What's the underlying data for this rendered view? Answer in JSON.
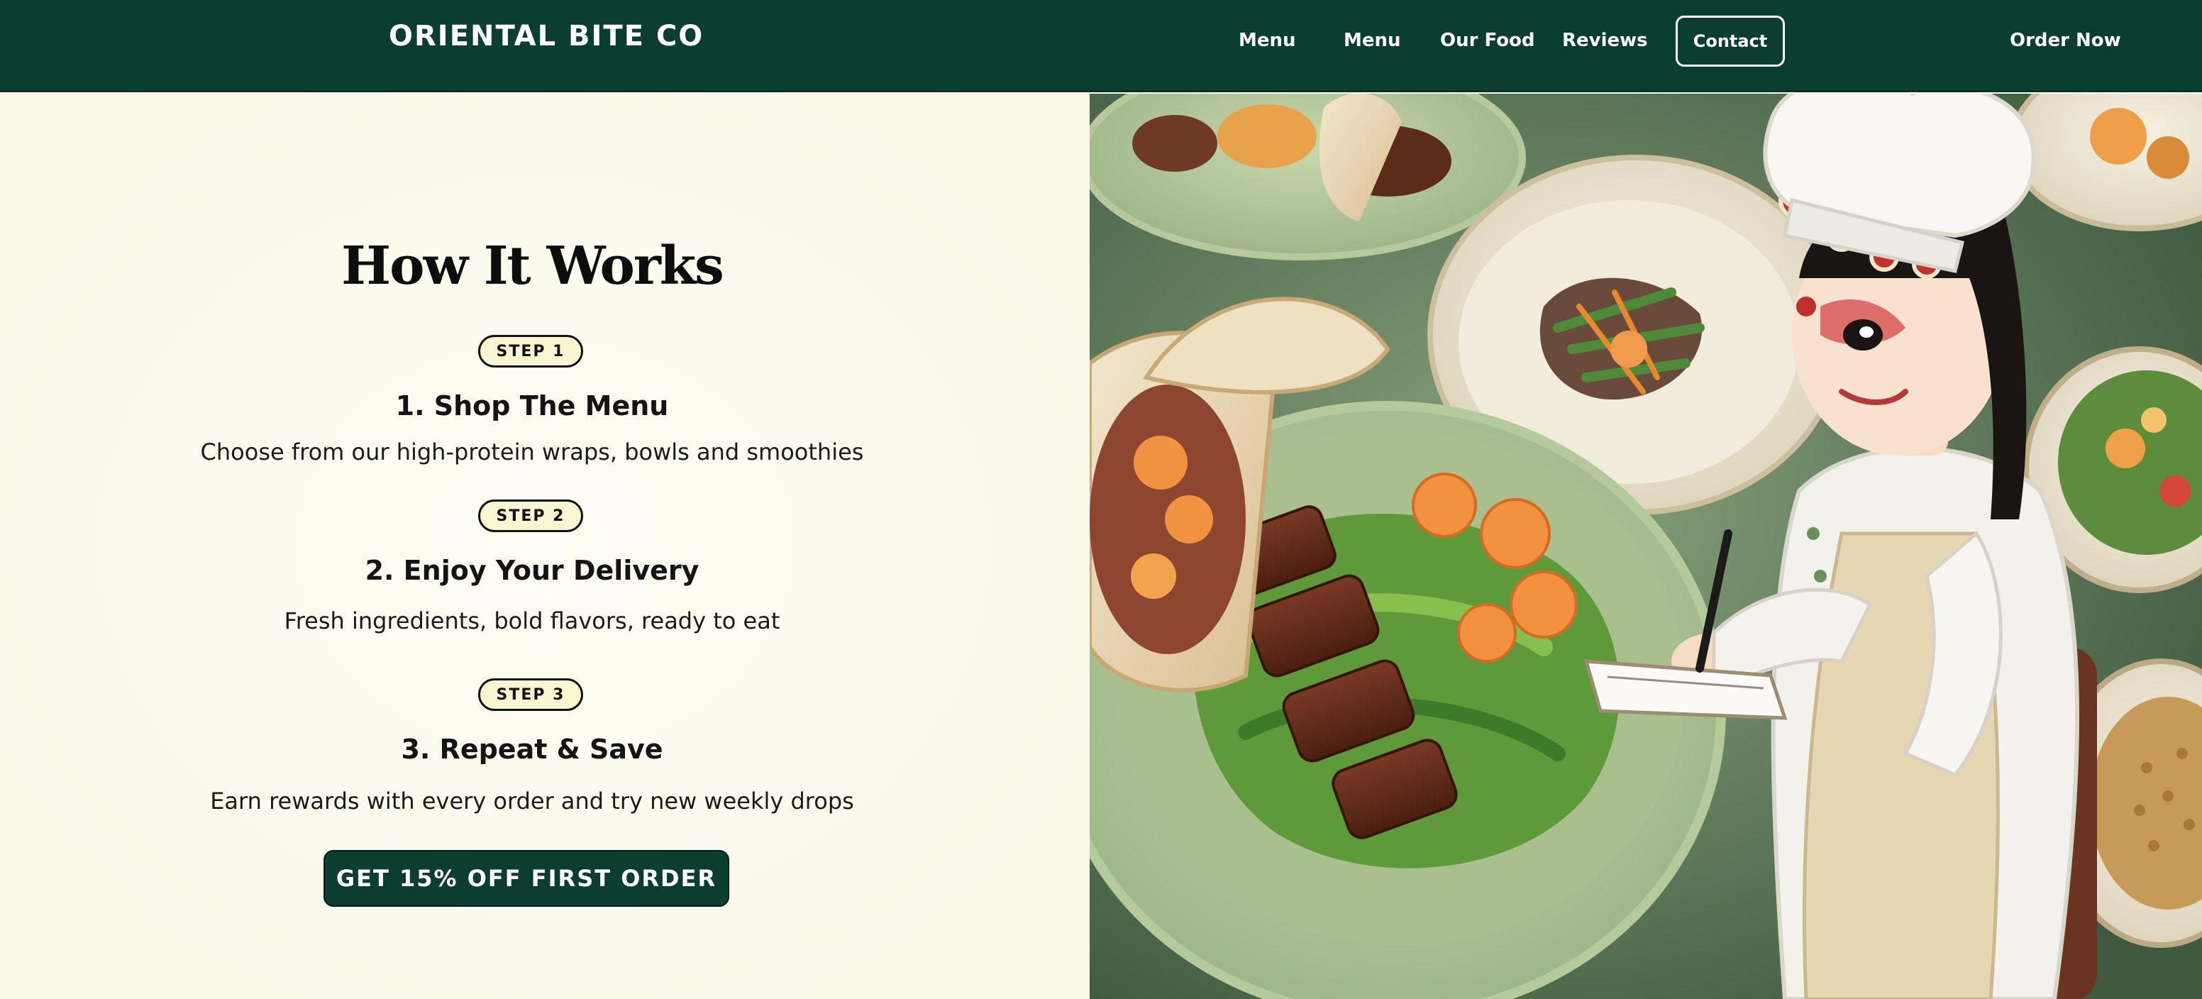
{
  "header": {
    "logo": "ORIENTAL BITE CO",
    "nav": [
      "Menu",
      "Menu",
      "Our Food",
      "Reviews"
    ],
    "contact": "Contact",
    "order_now": "Order Now"
  },
  "how_it_works": {
    "title": "How It Works",
    "steps": [
      {
        "badge": "STEP 1",
        "title": "1. Shop The Menu",
        "desc": "Choose from our high-protein wraps, bowls and smoothies"
      },
      {
        "badge": "STEP 2",
        "title": "2. Enjoy Your Delivery",
        "desc": "Fresh ingredients, bold flavors, ready to eat"
      },
      {
        "badge": "STEP 3",
        "title": "3. Repeat & Save",
        "desc": "Earn rewards with every order and try new weekly drops"
      }
    ],
    "cta": "GET 15% OFF FIRST ORDER"
  },
  "colors": {
    "brand_green": "#0b3d30",
    "page_bg": "#fbfbef",
    "badge_bg": "#fbf6d2"
  }
}
